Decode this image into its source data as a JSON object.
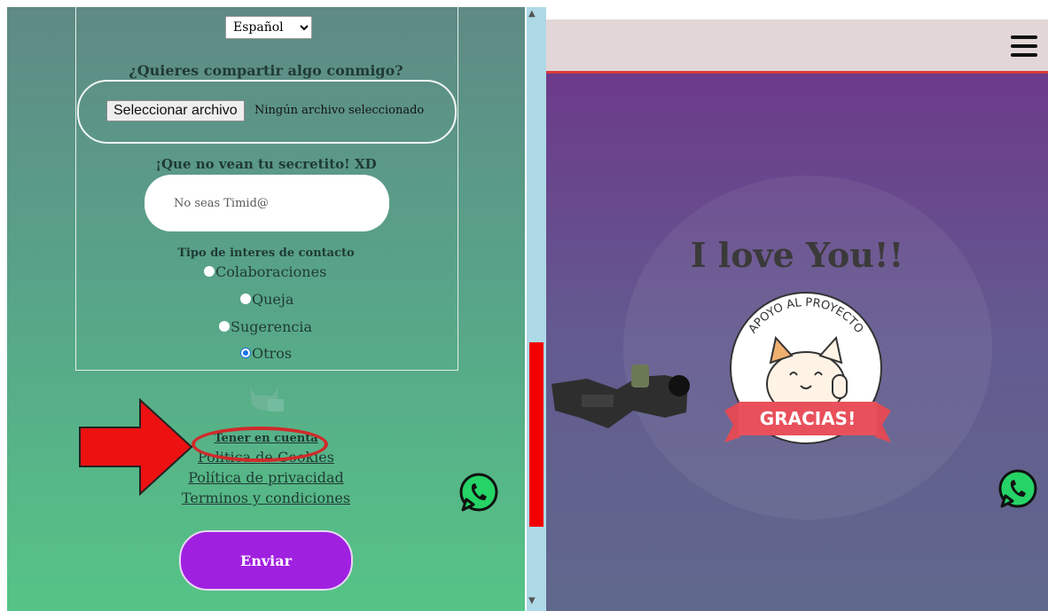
{
  "form": {
    "language_select": "Español",
    "share_label": "¿Quieres compartir algo conmigo?",
    "file_button": "Seleccionar archivo",
    "file_status": "Ningún archivo seleccionado",
    "secret_label": "¡Que no vean tu secretito! XD",
    "secret_placeholder": "No seas Timid@",
    "contact_type_label": "Tipo de interes de contacto",
    "contact_options": [
      {
        "label": "Colaboraciones",
        "checked": false
      },
      {
        "label": "Queja",
        "checked": false
      },
      {
        "label": "Sugerencia",
        "checked": false
      },
      {
        "label": "Otros",
        "checked": true
      }
    ],
    "links": {
      "tener_en_cuenta": "Tener en cuenta",
      "cookies": "Politica de Cookies",
      "privacy": "Política de privacidad",
      "terms": "Terminos y condiciones"
    },
    "send_button": "Enviar"
  },
  "right": {
    "love_text": "I love You!!",
    "badge_arc_text": "APOYO AL PROYECTO",
    "badge_banner": "GRACIAS!"
  },
  "colors": {
    "accent_purple": "#a020e0",
    "highlight_red": "#d12a2a",
    "scroll_thumb": "#f20000",
    "whatsapp_green": "#25d366"
  },
  "icons": [
    "chevron-down-icon",
    "whatsapp-icon",
    "hamburger-menu-icon",
    "cat-icon",
    "red-arrow-annotation"
  ]
}
